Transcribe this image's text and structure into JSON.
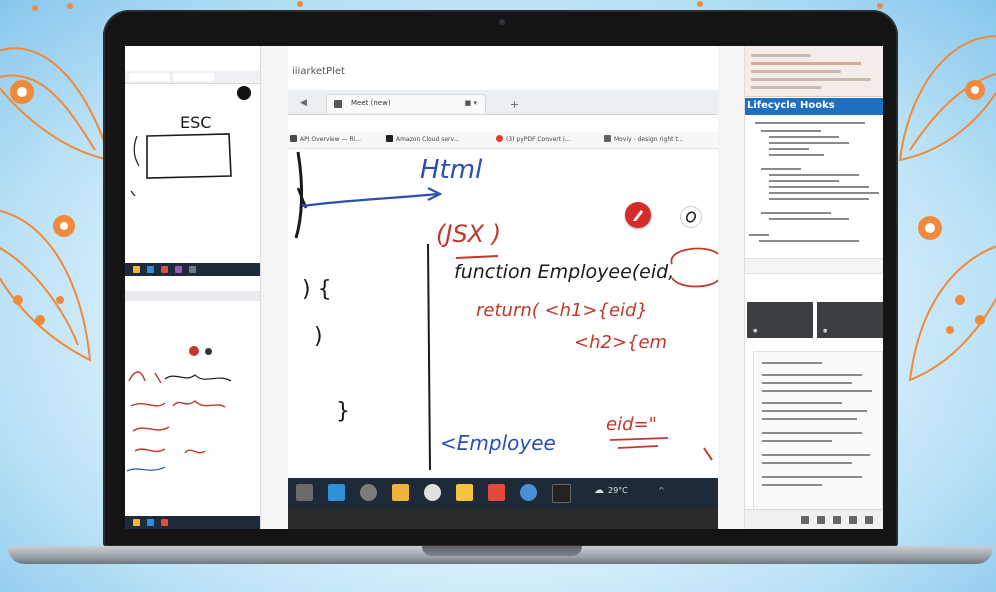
{
  "colors": {
    "marker_blue": "#2b4fb3",
    "marker_red": "#c0392b",
    "marker_black": "#1a1a1a",
    "decor_orange": "#f08a3a",
    "banner_blue": "#1e6fc0"
  },
  "left_pane": {
    "drawing_label": "ESC"
  },
  "center_pane": {
    "window_title": "iiiarketPlet",
    "tab_label": "Meet (new)",
    "bookmarks": [
      "API Overview — Ri...",
      "Amazon Cloud serv...",
      "(3) pyPDF Convert I...",
      "Moviy - design right t..."
    ],
    "handwriting": {
      "html": "Html",
      "jsx": "(JSX  )",
      "open_brace": ") {",
      "paren": ")",
      "close_brace": "}",
      "function_line": "function Employee(eid,",
      "return_line1": "return( <h1>{eid}",
      "return_line2": "<h2>{em",
      "component_line": "<Employee",
      "eid_attr": "eid=\""
    },
    "taskbar": {
      "weather": "29°C"
    }
  },
  "right_pane": {
    "banner": "Lifecycle Hooks"
  },
  "icons": {
    "pen": "pen-icon",
    "eraser": "eraser-icon",
    "windows": "windows-start-icon",
    "vscode": "vscode-icon",
    "chrome": "chrome-icon",
    "explorer": "file-explorer-icon",
    "weather": "weather-icon"
  }
}
